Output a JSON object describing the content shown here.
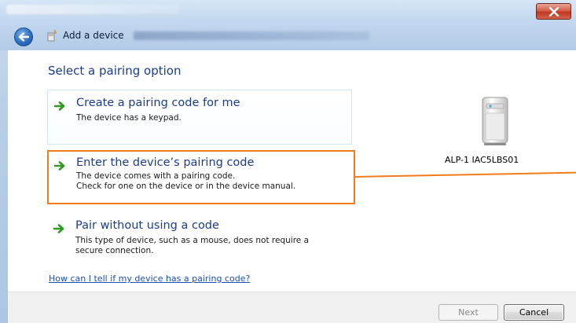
{
  "window": {
    "title": "Add a device",
    "close_icon": "close-icon",
    "back_icon": "back-arrow-icon",
    "colors": {
      "accent_orange": "#f07c1c",
      "heading_blue": "#1b3d8a",
      "link_blue": "#1a4fb8"
    }
  },
  "page": {
    "heading": "Select a pairing option"
  },
  "options": [
    {
      "title": "Create a pairing code for me",
      "desc1": "The device has a keypad.",
      "desc2": "",
      "icon": "green-arrow-icon"
    },
    {
      "title": "Enter the device’s pairing code",
      "desc1": "The device comes with a pairing code.",
      "desc2": "Check for one on the device or in the device manual.",
      "icon": "green-arrow-icon"
    },
    {
      "title": "Pair without using a code",
      "desc1": "This type of device, such as a mouse, does not require a",
      "desc2": "secure connection.",
      "icon": "green-arrow-icon"
    }
  ],
  "help_link": "How can I tell if my device has a pairing code?",
  "device": {
    "name": "ALP-1 IAC5LBS01",
    "icon": "computer-tower-icon"
  },
  "footer": {
    "next_label": "Next",
    "cancel_label": "Cancel"
  }
}
